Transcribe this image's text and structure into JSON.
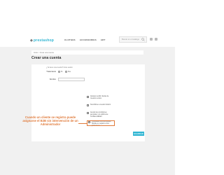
{
  "header": {
    "logo_text": "prestashop",
    "nav": [
      "CLOTHES",
      "ACCESSORIES",
      "ART"
    ],
    "search_placeholder": "Buscar en el catálogo"
  },
  "breadcrumb": {
    "home": "Inicio",
    "current": "Crear una cuenta"
  },
  "page": {
    "title": "Crear una cuenta"
  },
  "form": {
    "login_prompt": "¿Ya tiene una cuenta? Inicie sesión",
    "fields": {
      "title_label": "Tratamiento",
      "radio_options": [
        "Sr.",
        "Sra."
      ],
      "first_name_label": "Nombre"
    },
    "checkboxes": [
      "Quisiera recibir ofertas de nuestros socios",
      "Suscribirse a nuestro boletín",
      "Acepto las condiciones generales y la política de confidencialidad",
      "¿Asociado a una empresa? Solicite su registro como profesional"
    ],
    "save_label": "GUARDAR"
  },
  "annotation": {
    "text": "Cuando un cliente se registra puede asignarse el B2B sin intervención de un Administrador"
  }
}
